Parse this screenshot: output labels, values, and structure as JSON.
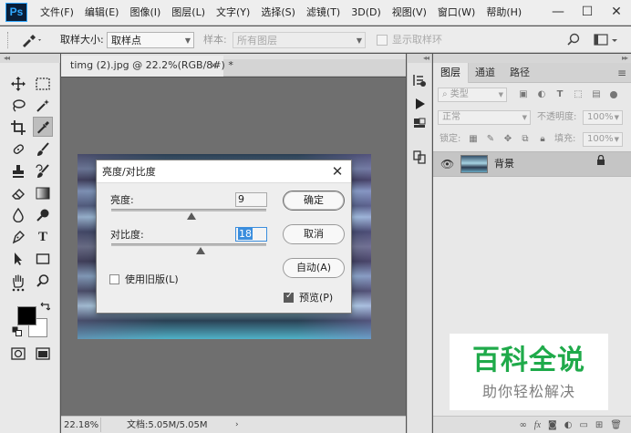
{
  "app": {
    "logo": "Ps",
    "menus": [
      "文件(F)",
      "编辑(E)",
      "图像(I)",
      "图层(L)",
      "文字(Y)",
      "选择(S)",
      "滤镜(T)",
      "3D(D)",
      "视图(V)",
      "窗口(W)",
      "帮助(H)"
    ],
    "window_controls": [
      "—",
      "☐",
      "✕"
    ]
  },
  "options_bar": {
    "sample_size_label": "取样大小:",
    "sample_size_value": "取样点",
    "sample_label": "样本:",
    "sample_value": "所有图层",
    "show_ring_label": "显示取样环"
  },
  "document": {
    "tab_title": "timg (2).jpg @ 22.2%(RGB/8#) *",
    "tab_close": "×",
    "zoom": "22.18%",
    "doc_info": "文档:5.05M/5.05M",
    "status_arrow": "›"
  },
  "dialog": {
    "title": "亮度/对比度",
    "close": "✕",
    "brightness_label": "亮度:",
    "brightness_value": "9",
    "contrast_label": "对比度:",
    "contrast_value": "18",
    "legacy_label": "使用旧版(L)",
    "legacy_checked": false,
    "preview_label": "预览(P)",
    "preview_checked": true,
    "ok_label": "确定",
    "cancel_label": "取消",
    "auto_label": "自动(A)"
  },
  "layers_panel": {
    "tabs": [
      "图层",
      "通道",
      "路径"
    ],
    "filter_label": "类型",
    "blend_mode": "正常",
    "opacity_label": "不透明度:",
    "opacity_value": "100%",
    "lock_label": "锁定:",
    "fill_label": "填充:",
    "fill_value": "100%",
    "layer_name": "背景",
    "footer_icons": [
      "link-icon",
      "fx-icon",
      "mask-icon",
      "adjustment-icon",
      "folder-icon",
      "new-layer-icon",
      "trash-icon"
    ]
  },
  "watermark": {
    "title": "百科全说",
    "subtitle": "助你轻松解决"
  }
}
